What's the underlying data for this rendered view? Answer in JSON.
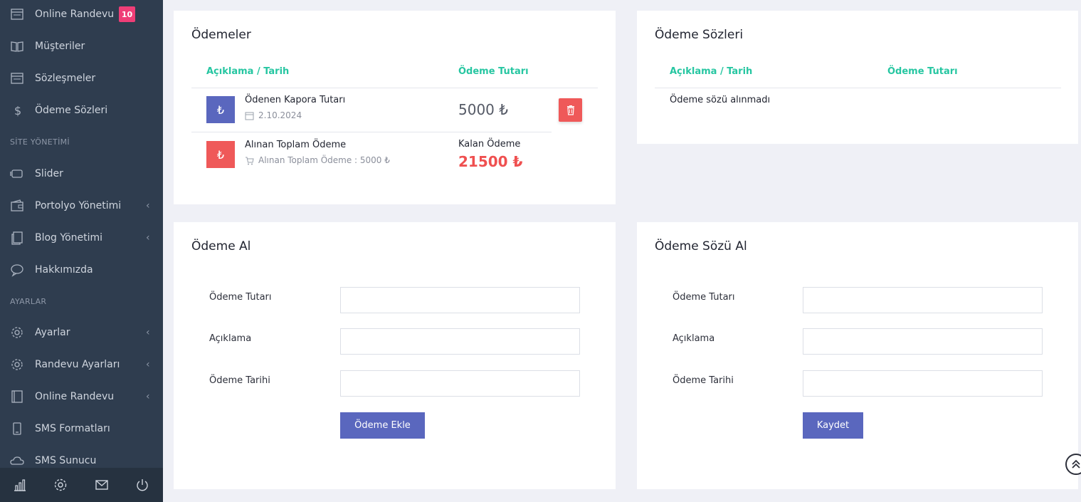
{
  "sidebar": {
    "items": [
      {
        "label": "Online Randevu",
        "icon": "calendar-icon",
        "badge": "10"
      },
      {
        "label": "Müşteriler",
        "icon": "book-icon"
      },
      {
        "label": "Sözleşmeler",
        "icon": "document-icon"
      },
      {
        "label": "Ödeme Sözleri",
        "icon": "dollar-icon"
      },
      {
        "label": "Slider",
        "icon": "slider-icon"
      },
      {
        "label": "Portolyo Yönetimi",
        "icon": "wallet-icon"
      },
      {
        "label": "Blog Yönetimi",
        "icon": "pages-icon"
      },
      {
        "label": "Hakkımızda",
        "icon": "chat-icon"
      },
      {
        "label": "Ayarlar",
        "icon": "gear-icon"
      },
      {
        "label": "Randevu Ayarları",
        "icon": "gear-icon"
      },
      {
        "label": "Online Randevu",
        "icon": "book-icon"
      },
      {
        "label": "SMS Formatları",
        "icon": "phone-icon"
      },
      {
        "label": "SMS Sunucu",
        "icon": "cloud-icon"
      }
    ],
    "headings": {
      "site": "SİTE YÖNETİMİ",
      "settings": "AYARLAR"
    },
    "chevron": "‹"
  },
  "payments": {
    "title": "Ödemeler",
    "col_desc": "Açıklama / Tarih",
    "col_amount": "Ödeme Tutarı",
    "row1": {
      "title": "Ödenen Kapora Tutarı",
      "date": "2.10.2024",
      "amount": "5000 ₺",
      "icon": "₺"
    },
    "row2": {
      "title": "Alınan Toplam Ödeme",
      "sub": "Alınan Toplam Ödeme : 5000 ₺",
      "remaining_label": "Kalan Ödeme",
      "remaining": "21500 ₺",
      "icon": "₺"
    }
  },
  "promises": {
    "title": "Ödeme Sözleri",
    "col_desc": "Açıklama / Tarih",
    "col_amount": "Ödeme Tutarı",
    "empty": "Ödeme sözü alınmadı"
  },
  "take_payment": {
    "title": "Ödeme Al",
    "amount_label": "Ödeme Tutarı",
    "desc_label": "Açıklama",
    "date_label": "Ödeme Tarihi",
    "button": "Ödeme Ekle"
  },
  "take_promise": {
    "title": "Ödeme Sözü Al",
    "amount_label": "Ödeme Tutarı",
    "desc_label": "Açıklama",
    "date_label": "Ödeme Tarihi",
    "button": "Kaydet"
  },
  "colors": {
    "sidebar": "#2f3d4f",
    "accent_green": "#26c6a1",
    "primary": "#5a67be",
    "danger": "#ef5959",
    "badge": "#ef3e77"
  }
}
